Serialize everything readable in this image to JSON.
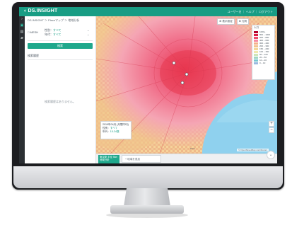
{
  "app": {
    "title": "DS.INSIGHT",
    "user_area": "ユーザー名 ｜ ヘルプ ｜ ログアウト"
  },
  "nav": {
    "icons": [
      "home-icon",
      "map-icon",
      "chart-icon",
      "folder-icon"
    ]
  },
  "breadcrumb": "DS.INSIGHT ＞ Placeマップ ＞ 地域分析",
  "filters": {
    "mesh_label": "□ MESH",
    "rows": [
      {
        "label": "性別：",
        "value": "すべて"
      },
      {
        "label": "年代：",
        "value": "すべて"
      }
    ]
  },
  "search_button": "検索",
  "results": {
    "header": "検索履歴",
    "empty_message": "検索履歴はありません。"
  },
  "map": {
    "toolbar": [
      "⊞ 表示設定",
      "⊞ 凡例"
    ],
    "legend_title": "人口",
    "legend": [
      {
        "label": "1000+",
        "color": "#b3002a"
      },
      {
        "label": "800 – 1000",
        "color": "#d91d43"
      },
      {
        "label": "600 – 800",
        "color": "#ee4b6a"
      },
      {
        "label": "400 – 600",
        "color": "#f78aa0"
      },
      {
        "label": "300 – 400",
        "color": "#f5b08a"
      },
      {
        "label": "200 – 300",
        "color": "#f2c48e"
      },
      {
        "label": "150 – 200",
        "color": "#f4d89a"
      },
      {
        "label": "100 – 150",
        "color": "#f0e7ad"
      },
      {
        "label": "50 – 100",
        "color": "#cfe6b9"
      },
      {
        "label": "20 – 50",
        "color": "#9fd6c2"
      },
      {
        "label": "10 – 20",
        "color": "#78c6cf"
      },
      {
        "label": "0 – 10",
        "color": "#9ab9e0"
      }
    ],
    "info": {
      "title": "2019年04月 (月間平均)",
      "rows": [
        {
          "label": "性別：",
          "value": "すべて"
        },
        {
          "label": "年代：",
          "value": "15-34歳"
        }
      ]
    },
    "zoom_in": "+",
    "zoom_out": "−",
    "attribution": "© OpenStreetMap contributors",
    "scale_label": "2 km"
  },
  "bottom": {
    "area_tab": "東京駅 半径 5km 地域分析",
    "add_area": "+ 地域を追加",
    "collapse": "⌄"
  }
}
